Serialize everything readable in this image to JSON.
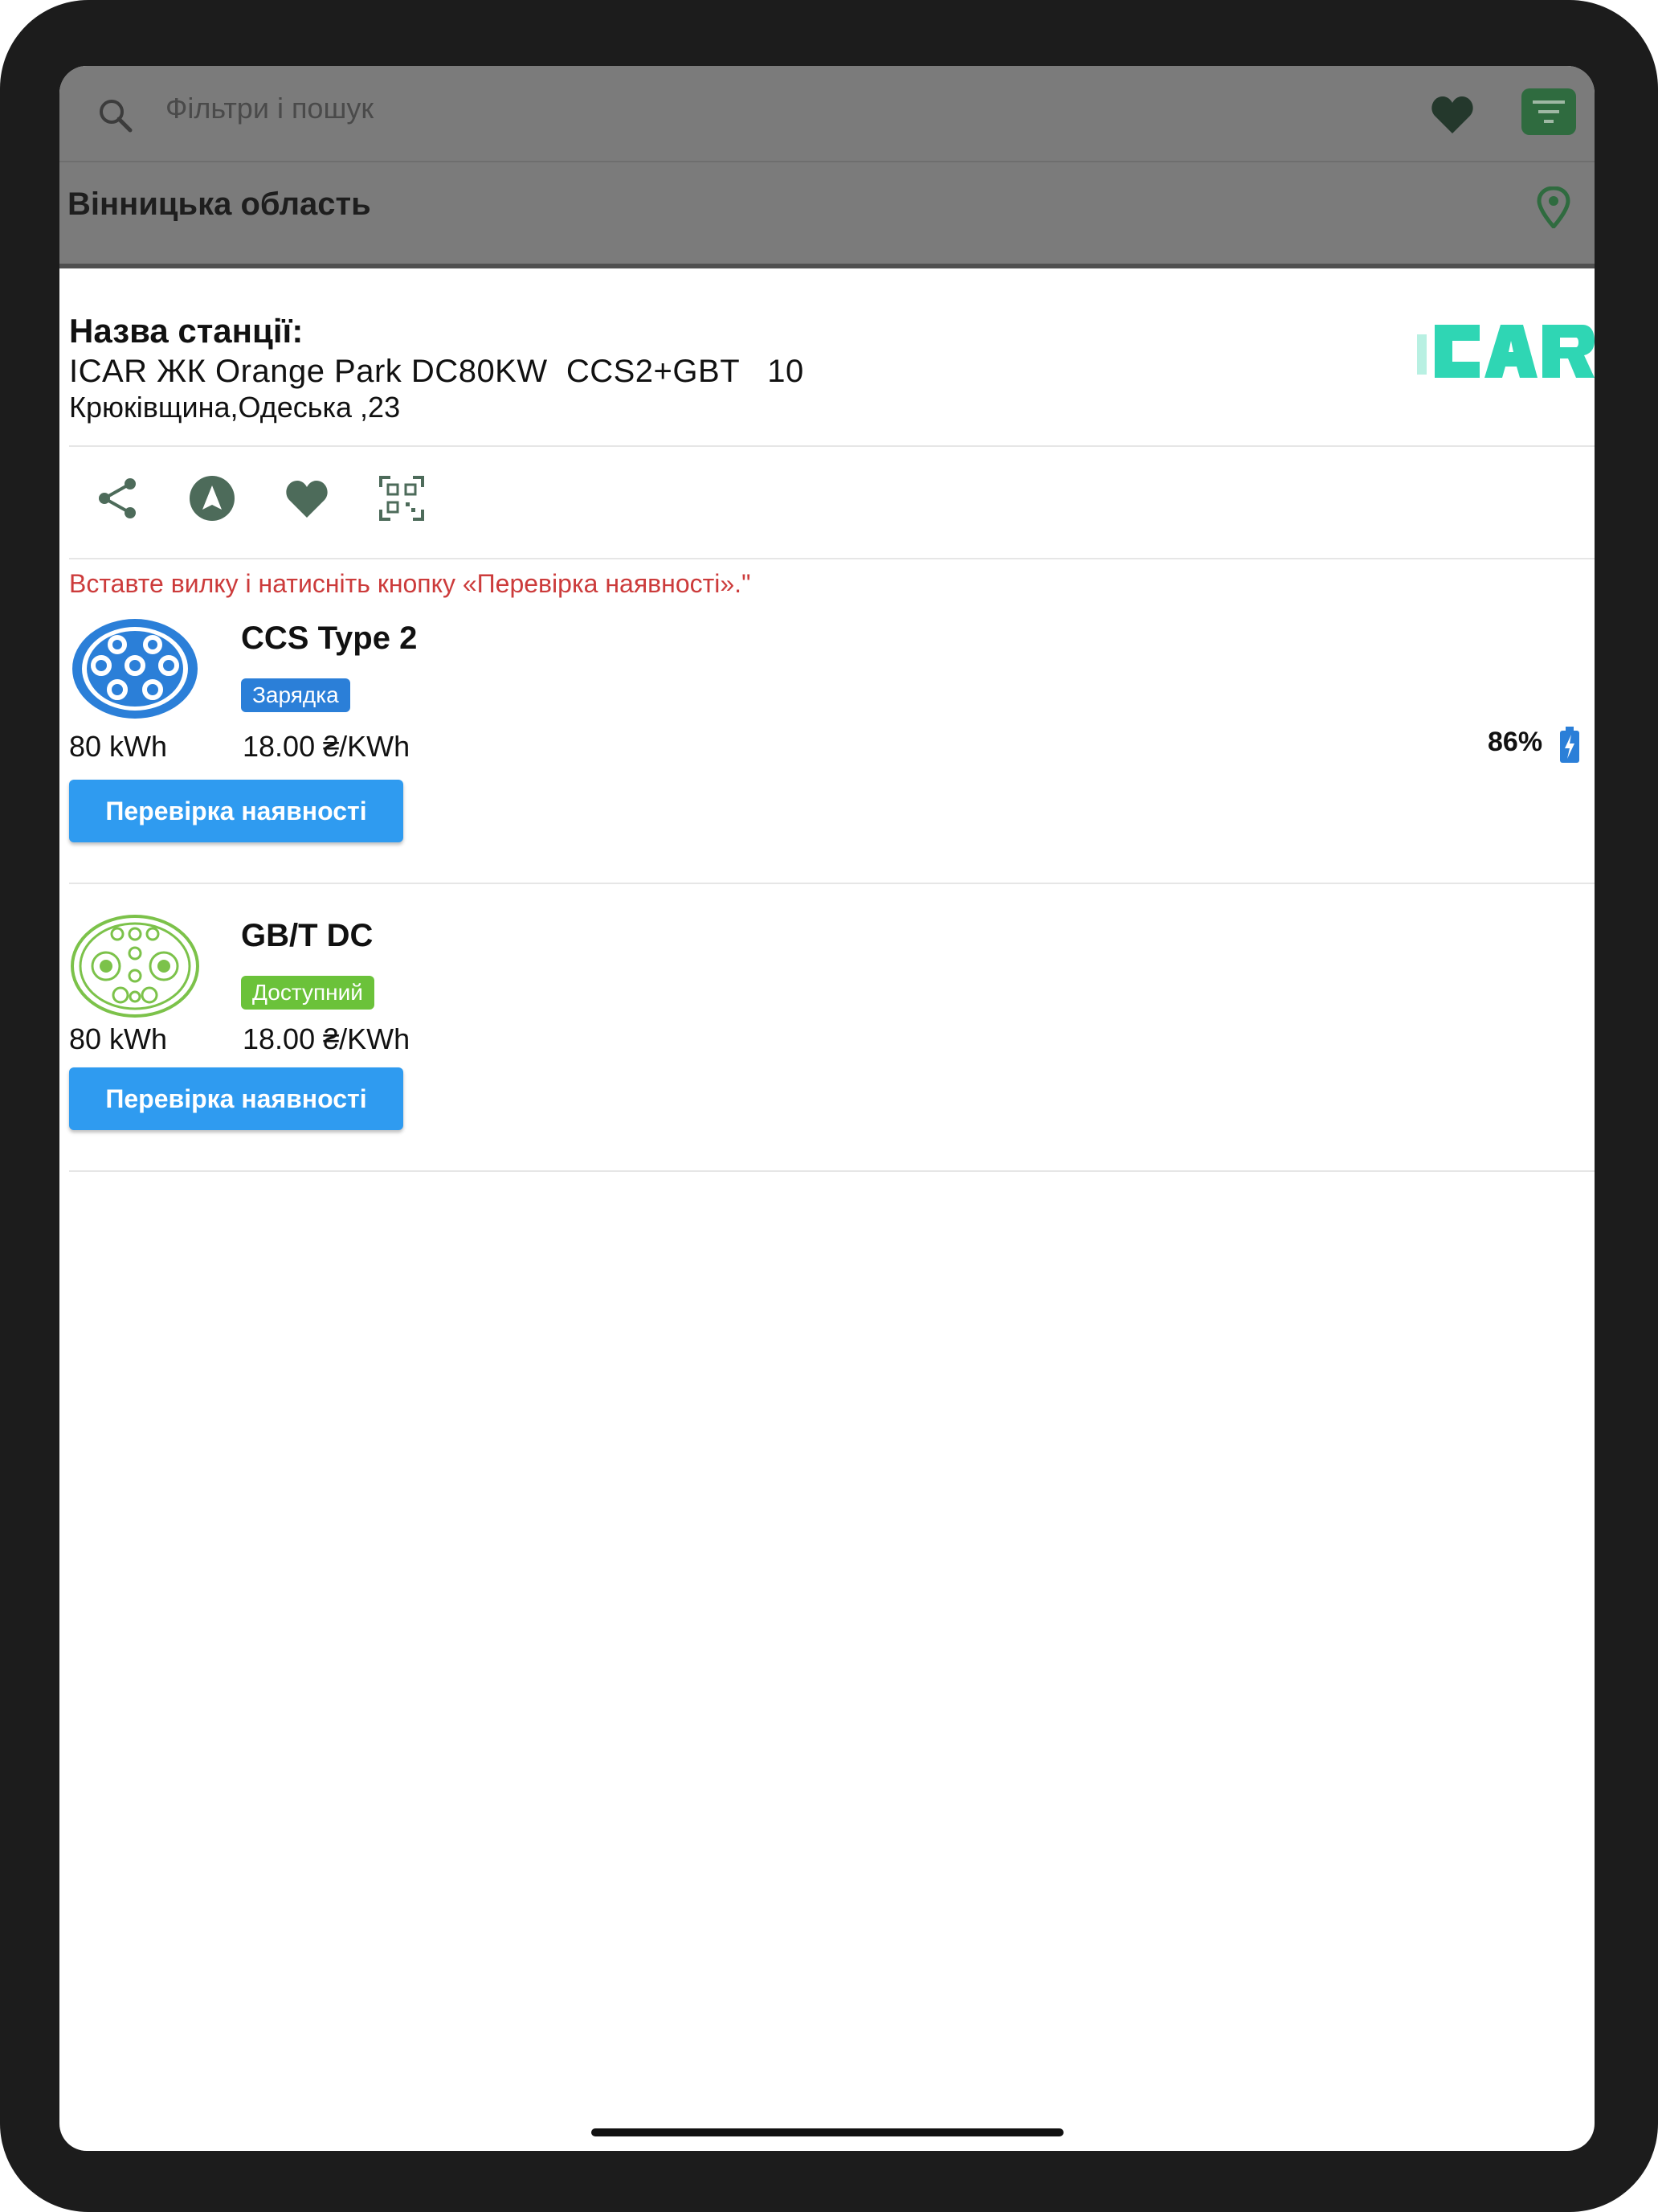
{
  "search": {
    "placeholder": "Фільтри і пошук"
  },
  "region": {
    "name": "Вінницька область"
  },
  "station": {
    "label": "Назва станції:",
    "name": "ICAR ЖК Orange Park DC80KW  CCS2+GBT   10",
    "address": "Крюківщина,Одеська ,23",
    "logo_text": "ICAR"
  },
  "actions": [
    "share-icon",
    "navigate-icon",
    "favorite-icon",
    "qr-code-icon"
  ],
  "notice": "Вставте вилку і натисніть кнопку «Перевірка наявності».\"",
  "connectors": [
    {
      "type": "CCS Type 2",
      "status": "Зарядка",
      "status_color": "#2b7fd8",
      "power": "80 kWh",
      "price": "18.00 ₴/KWh",
      "charge_percent": "86%",
      "button": "Перевірка наявності"
    },
    {
      "type": "GB/T DC",
      "status": "Доступний",
      "status_color": "#6bc23a",
      "power": "80 kWh",
      "price": "18.00 ₴/KWh",
      "button": "Перевірка наявності"
    }
  ],
  "colors": {
    "accent": "#2f9bf0",
    "icon": "#4d6b5a",
    "brand_green": "#2f6b3f",
    "notice": "#cc3b3b"
  }
}
